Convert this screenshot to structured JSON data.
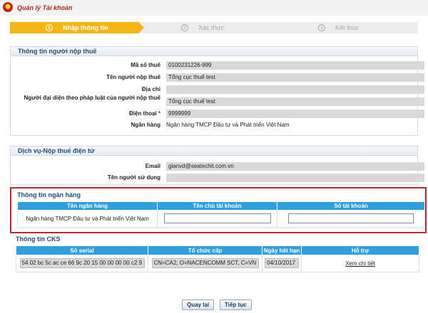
{
  "window": {
    "title": "Quản lý Tài khoản"
  },
  "wizard": {
    "steps": [
      {
        "num": "1",
        "label": "Nhập thông tin"
      },
      {
        "num": "2",
        "label": "Xác thực"
      },
      {
        "num": "3",
        "label": "Kết thúc"
      }
    ],
    "active_color": "#f6b514"
  },
  "taxpayer": {
    "header": "Thông tin người nộp thuế",
    "fields": [
      {
        "label": "Mã số thuế",
        "value": "0100231226-999"
      },
      {
        "label": "Tên người nộp thuế",
        "value": "Tổng cục thuế test"
      },
      {
        "label": "Địa chỉ",
        "value": ""
      },
      {
        "label": "Người đại diện theo pháp luật của người nộp thuế",
        "value": "Tổng cục thuế test"
      },
      {
        "label": "Điện thoại",
        "required_mark": "*",
        "value": "9999999"
      },
      {
        "label": "Ngân hàng",
        "value": "Ngân hàng TMCP Đầu tư và Phát triển Việt Nam"
      }
    ]
  },
  "service": {
    "header": "Dịch vụ-Nộp thuế điện tử",
    "fields": [
      {
        "label": "Email",
        "value": "gianvd@seatechit.com.vn"
      },
      {
        "label": "Tên người sử dụng",
        "value": ""
      }
    ]
  },
  "bank_info": {
    "header": "Thông tin ngân hàng",
    "columns": [
      "Tên ngân hàng",
      "Tên chủ tài khoản",
      "Số tài khoản"
    ],
    "row": {
      "bank_name": "Ngân hàng TMCP Đầu tư và Phát triển Việt Nam",
      "account_holder": "",
      "account_number": ""
    },
    "highlight_color": "#c0272d"
  },
  "cks": {
    "header": "Thông tin CKS",
    "columns": [
      "Số serial",
      "Tổ chức cấp",
      "Ngày hết hạn",
      "Hỗ trợ"
    ],
    "row": {
      "serial": "54 02 bc 5c ac ce 66 9c 20 15 00 00 00 00 c2 9",
      "issuer": "CN=CA2, O=NACENCOMM SCT, C=VN",
      "expiry": "04/10/2017",
      "support_link": "Xem chi tiết"
    }
  },
  "buttons": {
    "back": "Quay lại",
    "next": "Tiếp tục"
  },
  "colors": {
    "table_header": "#2f9fe0",
    "section_title": "#1f4e79"
  }
}
